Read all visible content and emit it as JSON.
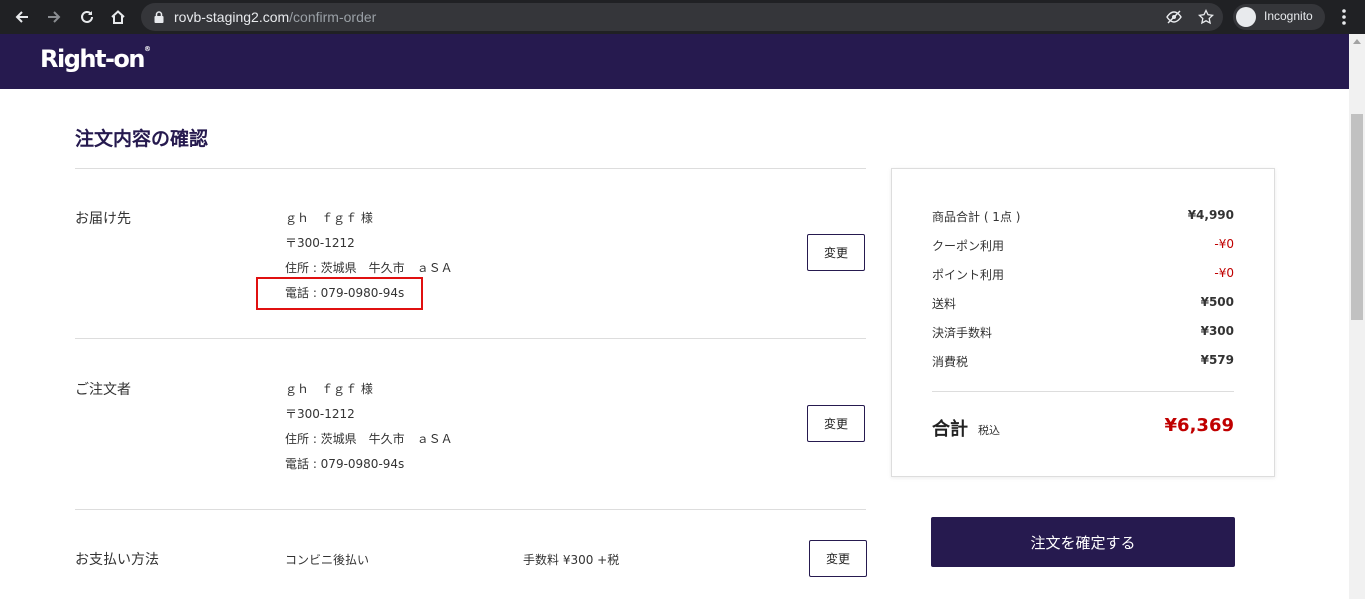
{
  "browser": {
    "url_host": "rovb-staging2.com",
    "url_path": "/confirm-order",
    "profile_label": "Incognito"
  },
  "header": {
    "logo_text": "Right-on",
    "logo_mark": "®"
  },
  "page": {
    "title": "注文内容の確認"
  },
  "delivery": {
    "label": "お届け先",
    "name": "ｇｈ　ｆｇｆ 様",
    "postal": "〒300-1212",
    "address": "住所 : 茨城県　牛久市　ａＳＡ",
    "phone": "電話 : 079-0980-94s",
    "change_label": "変更"
  },
  "orderer": {
    "label": "ご注文者",
    "name": "ｇｈ　ｆｇｆ 様",
    "postal": "〒300-1212",
    "address": "住所 : 茨城県　牛久市　ａＳＡ",
    "phone": "電話 : 079-0980-94s",
    "change_label": "変更"
  },
  "payment": {
    "label": "お支払い方法",
    "method": "コンビニ後払い",
    "fee": "手数料 ¥300 +税",
    "change_label": "変更"
  },
  "summary": {
    "rows": [
      {
        "label": "商品合計 ( 1点 )",
        "value": "¥4,990"
      },
      {
        "label": "クーポン利用",
        "value": "-¥0"
      },
      {
        "label": "ポイント利用",
        "value": "-¥0"
      },
      {
        "label": "送料",
        "value": "¥500"
      },
      {
        "label": "決済手数料",
        "value": "¥300"
      },
      {
        "label": "消費税",
        "value": "¥579"
      }
    ],
    "total_label": "合計",
    "total_tax_note": "税込",
    "total_value": "¥6,369"
  },
  "actions": {
    "confirm_label": "注文を確定する"
  },
  "colors": {
    "brand": "#261a4f",
    "price_red": "#c00000",
    "highlight": "#e01010"
  }
}
